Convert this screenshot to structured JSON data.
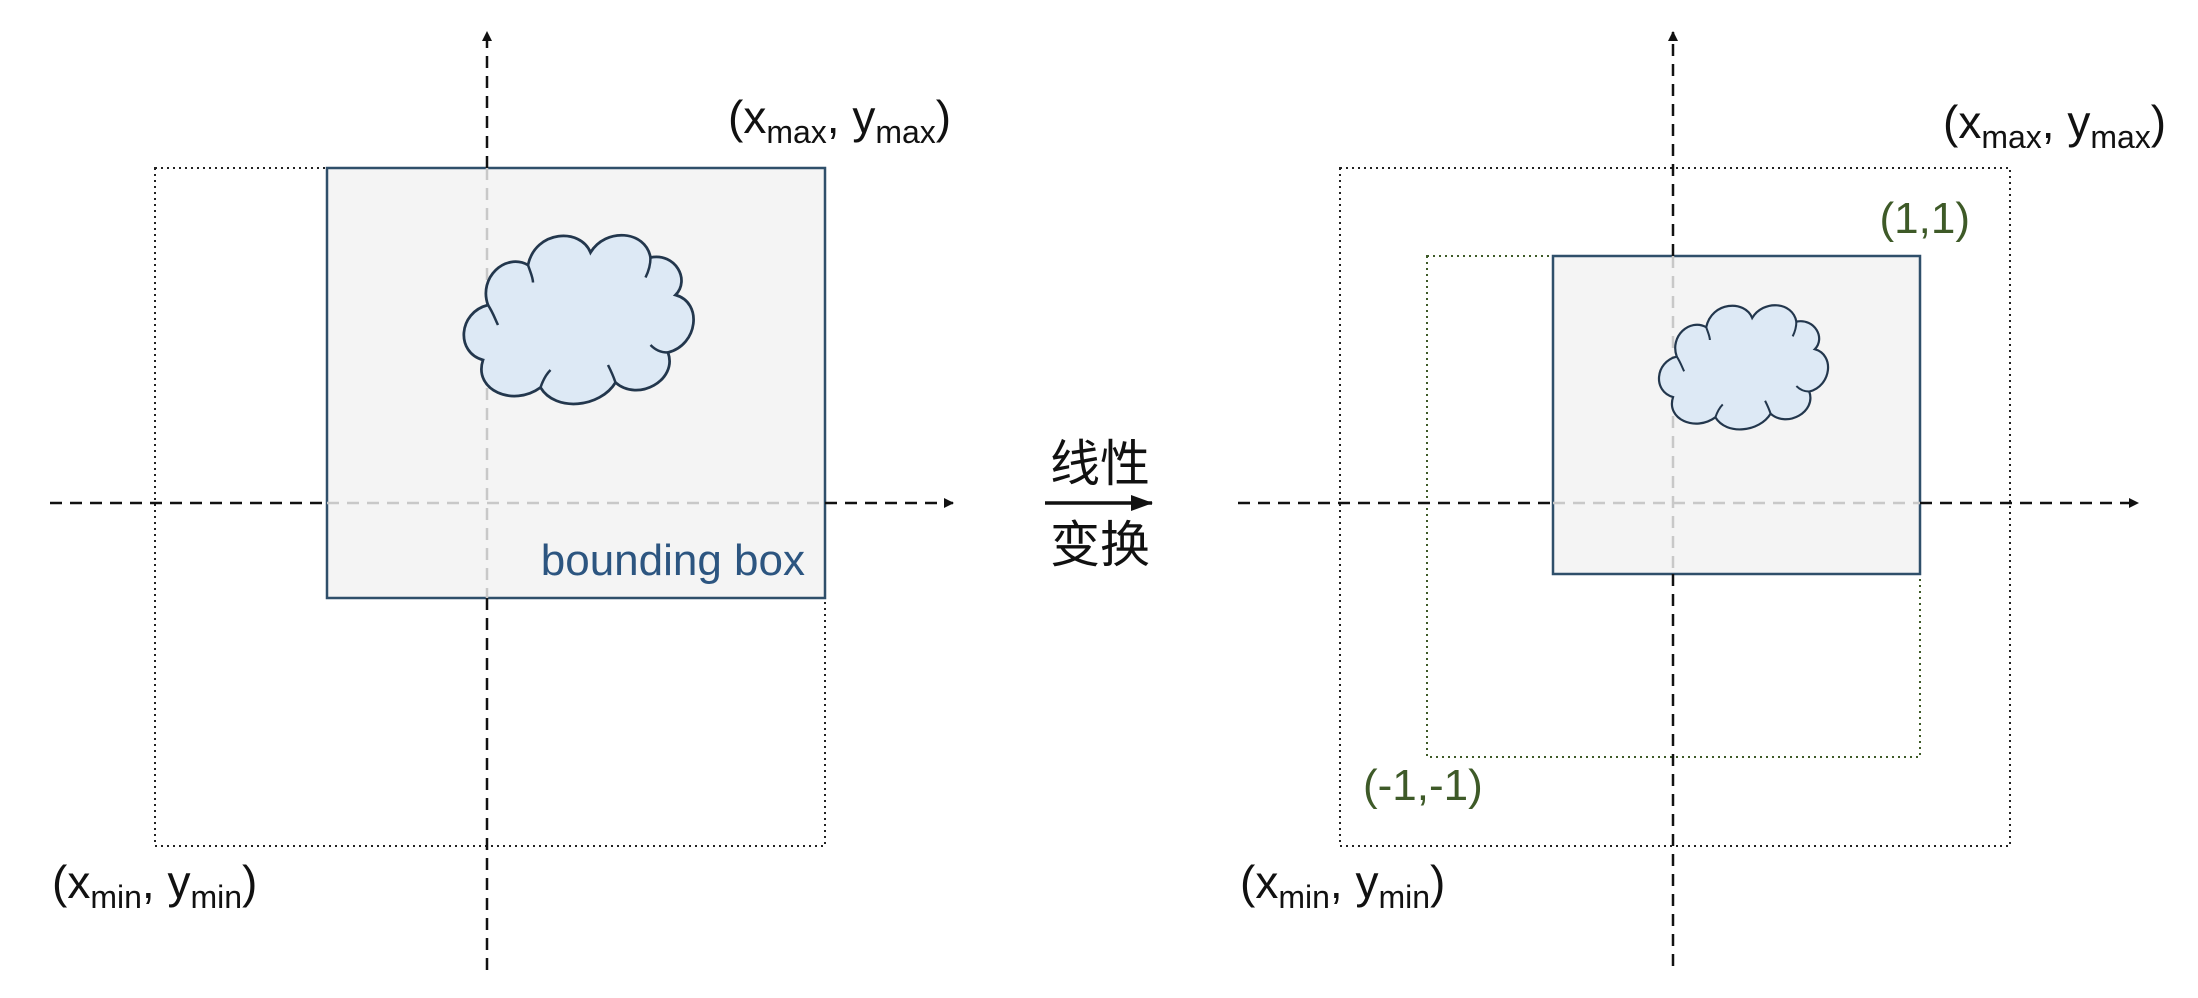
{
  "left_panel": {
    "bbox_label": "bounding box",
    "max_corner": {
      "open": "(x",
      "x_sub": "max",
      "mid": ", y",
      "y_sub": "max",
      "close": ")"
    },
    "min_corner": {
      "open": "(x",
      "x_sub": "min",
      "mid": ", y",
      "y_sub": "min",
      "close": ")"
    }
  },
  "transform_label": {
    "top": "线性",
    "bottom": "变换"
  },
  "right_panel": {
    "max_corner": {
      "open": "(x",
      "x_sub": "max",
      "mid": ", y",
      "y_sub": "max",
      "close": ")"
    },
    "min_corner": {
      "open": "(x",
      "x_sub": "min",
      "mid": ", y",
      "y_sub": "min",
      "close": ")"
    },
    "ndc_max_label": "(1,1)",
    "ndc_min_label": "(-1,-1)"
  },
  "colors": {
    "axis": "#111111",
    "bbox_fill": "#f4f4f4",
    "bbox_stroke": "#2f4f6a",
    "cloud_fill": "#dde9f5",
    "cloud_stroke": "#23374d",
    "ndc_stroke": "#3e5a28",
    "inner_axis": "#c8c8c8",
    "text_blue": "#2c5580",
    "text_green": "#3e5a28"
  }
}
